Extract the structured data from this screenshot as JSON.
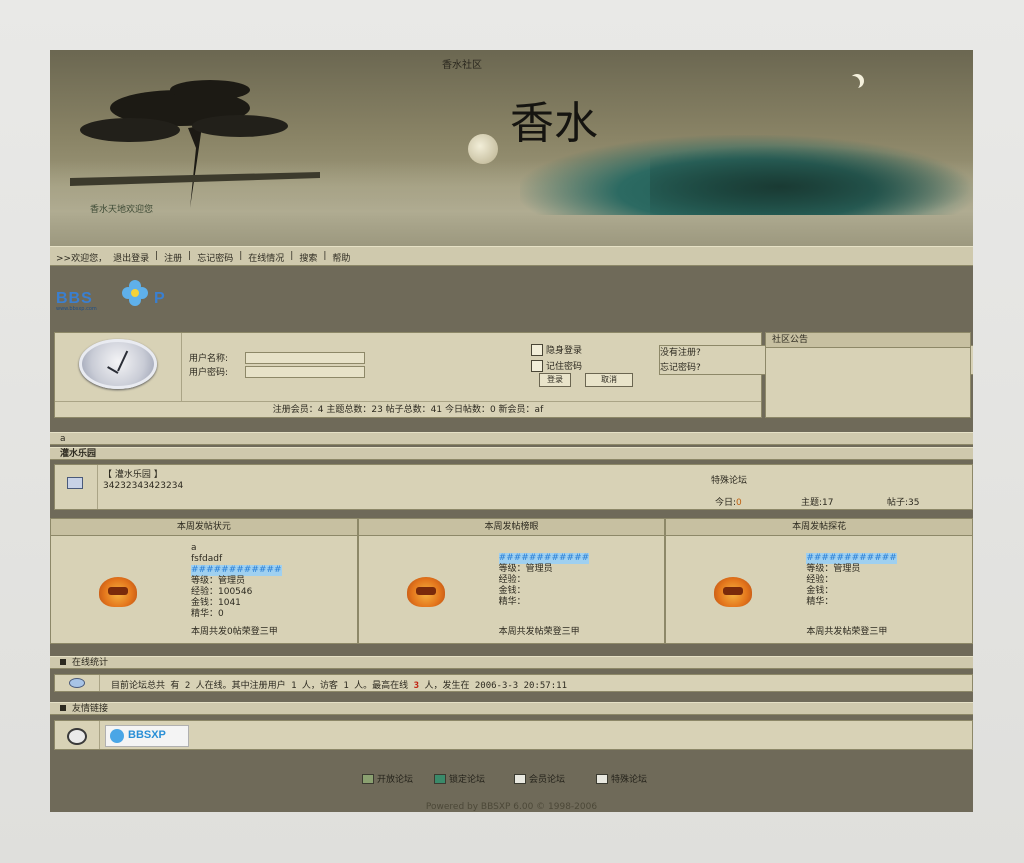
{
  "banner": {
    "calligraphy": "香水",
    "seal_text": "香水社区",
    "subtitle": "香水天地欢迎您"
  },
  "nav": {
    "items": [
      ">>欢迎您，",
      "退出登录",
      "注册",
      "忘记密码",
      "在线情况",
      "搜索",
      "帮助"
    ]
  },
  "logo": {
    "text": "BBS",
    "suffix": "P",
    "sub": "www.bbsxp.com"
  },
  "login": {
    "username_label": "用户名称:",
    "password_label": "用户密码:",
    "remember_login": "隐身登录",
    "remember_password": "记住密码",
    "login_button": "登录",
    "cancel_button": "取消",
    "not_registered": "没有注册?",
    "forgot_password": "忘记密码?",
    "stats": "注册会员：4   主题总数：23   帖子总数：41   今日帖数：0   新会员：af"
  },
  "notice": {
    "title": "社区公告"
  },
  "category": {
    "label": "a",
    "name": "灌水乐园"
  },
  "forum": {
    "title": "【 灌水乐园 】",
    "desc": "34232343423234",
    "moderator": "特殊论坛",
    "today_label": "今日:",
    "today_value": "0",
    "topics": "主题:17",
    "posts": "帖子:35"
  },
  "weekly": [
    {
      "title": "本周发帖状元",
      "name": "a",
      "sub": "fsfdadf",
      "highlight": "############",
      "rank": "等级：管理员",
      "exp": "经验：100546",
      "money": "金钱：1041",
      "elite": "精华：0",
      "footer": "本周共发0帖荣登三甲"
    },
    {
      "title": "本周发帖榜眼",
      "name": "",
      "sub": "",
      "highlight": "############",
      "rank": "等级：管理员",
      "exp": "经验：",
      "money": "金钱：",
      "elite": "精华：",
      "footer": "本周共发帖荣登三甲"
    },
    {
      "title": "本周发帖探花",
      "name": "",
      "sub": "",
      "highlight": "############",
      "rank": "等级：管理员",
      "exp": "经验：",
      "money": "金钱：",
      "elite": "精华：",
      "footer": "本周共发帖荣登三甲"
    }
  ],
  "online": {
    "title": "在线统计",
    "text_a": "目前论坛总共 有 2 人在线。其中注册用户 1 人，访客 1 人。最高在线 ",
    "peak": "3",
    "text_b": " 人，发生在 2006-3-3 20:57:11"
  },
  "links": {
    "title": "友情链接",
    "badge": "BBSXP"
  },
  "legend": [
    "开放论坛",
    "锁定论坛",
    "会员论坛",
    "特殊论坛"
  ],
  "footer": "Powered by BBSXP 6.00 © 1998-2006",
  "colors": {
    "frame": "#6f6a59",
    "panel": "#d8d2b6",
    "bar": "#cfc9ad",
    "accent_blue": "#3a7fd0"
  }
}
